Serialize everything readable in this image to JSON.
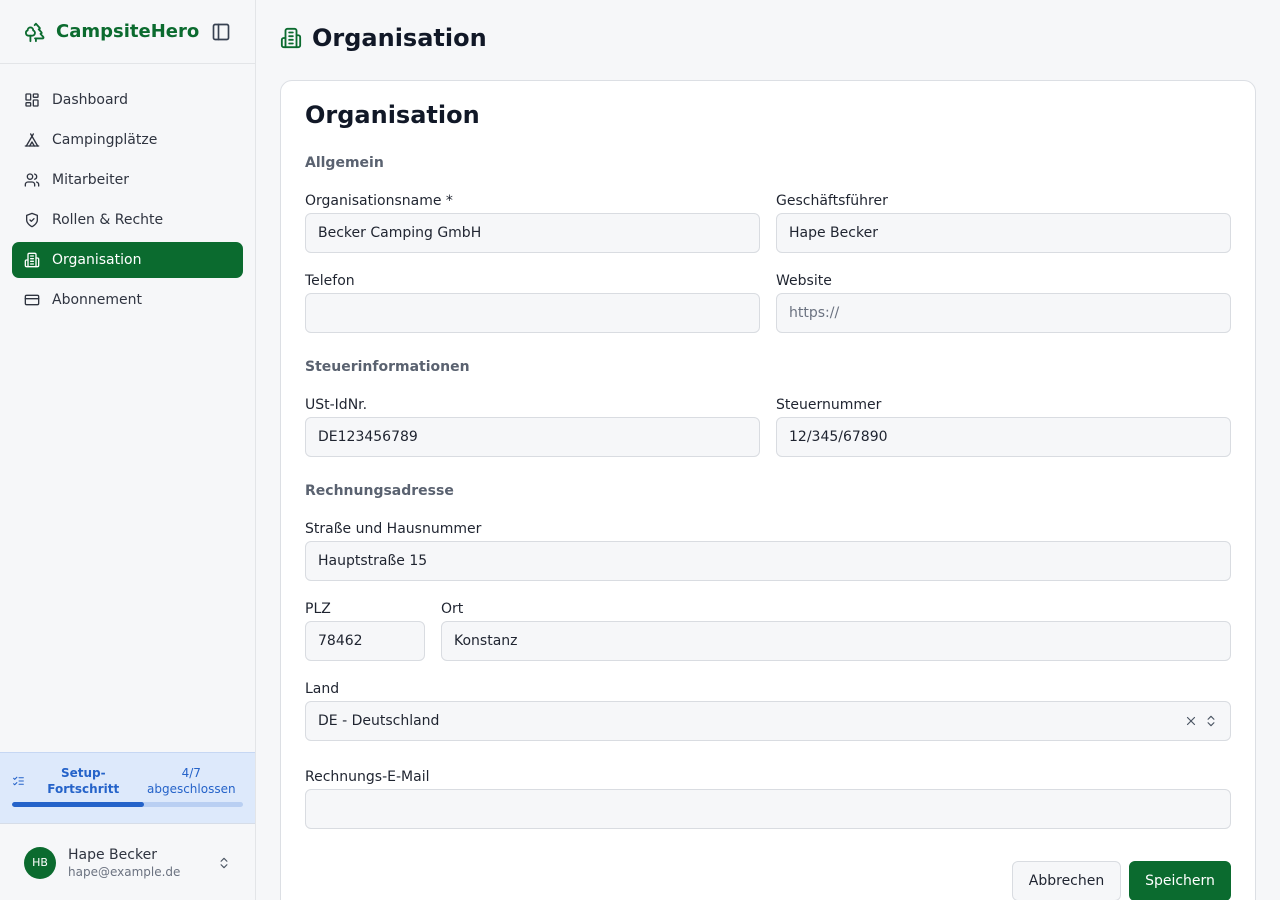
{
  "app": {
    "name": "CampsiteHero"
  },
  "sidebar": {
    "items": [
      {
        "label": "Dashboard"
      },
      {
        "label": "Campingplätze"
      },
      {
        "label": "Mitarbeiter"
      },
      {
        "label": "Rollen & Rechte"
      },
      {
        "label": "Organisation"
      },
      {
        "label": "Abonnement"
      }
    ],
    "active_item": "Organisation"
  },
  "setup": {
    "title": "Setup-Fortschritt",
    "count": "4/7 abgeschlossen",
    "progress_fraction": 0.5714
  },
  "user": {
    "initials": "HB",
    "name": "Hape Becker",
    "email": "hape@example.de"
  },
  "page": {
    "title": "Organisation"
  },
  "form": {
    "title": "Organisation",
    "sections": {
      "general": "Allgemein",
      "tax": "Steuerinformationen",
      "billing": "Rechnungsadresse"
    },
    "fields": {
      "org_name": {
        "label": "Organisationsname *",
        "value": "Becker Camping GmbH"
      },
      "ceo": {
        "label": "Geschäftsführer",
        "value": "Hape Becker"
      },
      "phone": {
        "label": "Telefon",
        "value": ""
      },
      "website": {
        "label": "Website",
        "value": "",
        "placeholder": "https://"
      },
      "vat_id": {
        "label": "USt-IdNr.",
        "value": "DE123456789"
      },
      "tax_number": {
        "label": "Steuernummer",
        "value": "12/345/67890"
      },
      "street": {
        "label": "Straße und Hausnummer",
        "value": "Hauptstraße 15"
      },
      "zip": {
        "label": "PLZ",
        "value": "78462"
      },
      "city": {
        "label": "Ort",
        "value": "Konstanz"
      },
      "country": {
        "label": "Land",
        "value": "DE - Deutschland"
      },
      "billing_email": {
        "label": "Rechnungs-E-Mail",
        "value": ""
      }
    },
    "buttons": {
      "cancel": "Abbrechen",
      "save": "Speichern"
    }
  },
  "colors": {
    "brand": "#0b6b2f",
    "progress": "#2563c9",
    "setup_bg": "#dde9fb"
  }
}
